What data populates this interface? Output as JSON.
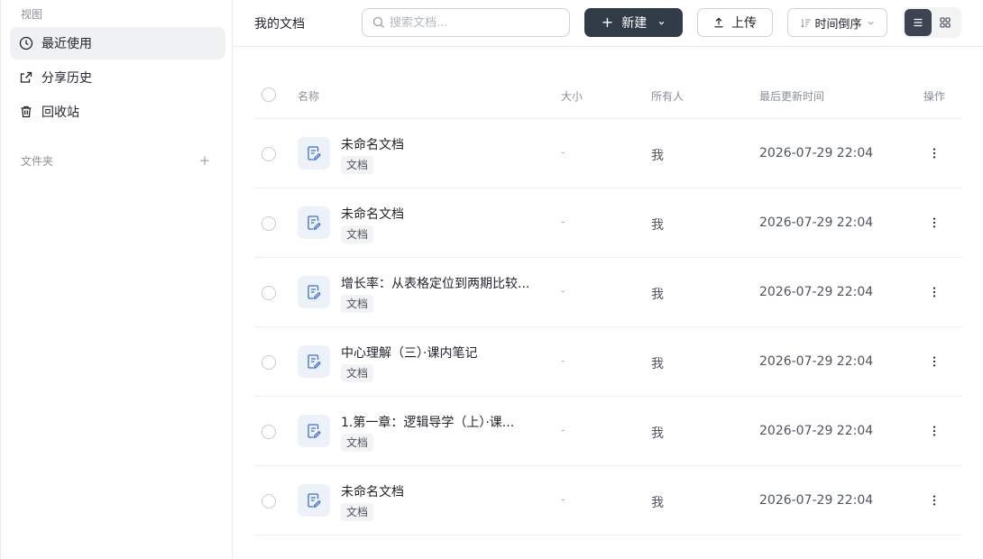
{
  "sidebar": {
    "view_label": "视图",
    "items": [
      {
        "label": "最近使用",
        "icon": "clock-icon",
        "active": true
      },
      {
        "label": "分享历史",
        "icon": "share-icon",
        "active": false
      },
      {
        "label": "回收站",
        "icon": "trash-icon",
        "active": false
      }
    ],
    "folder_label": "文件夹",
    "add_folder": "+"
  },
  "header": {
    "title": "我的文档",
    "search_placeholder": "搜索文档...",
    "new_label": "新建",
    "upload_label": "上传",
    "sort_label": "时间倒序"
  },
  "table": {
    "columns": {
      "name": "名称",
      "size": "大小",
      "owner": "所有人",
      "updated": "最后更新时间",
      "actions": "操作"
    },
    "rows": [
      {
        "name": "未命名文档",
        "tag": "文档",
        "size": "-",
        "owner": "我",
        "updated": "2026-07-29 22:04"
      },
      {
        "name": "未命名文档",
        "tag": "文档",
        "size": "-",
        "owner": "我",
        "updated": "2026-07-29 22:04"
      },
      {
        "name": "增长率：从表格定位到两期比较...",
        "tag": "文档",
        "size": "-",
        "owner": "我",
        "updated": "2026-07-29 22:04"
      },
      {
        "name": "中心理解（三）·课内笔记",
        "tag": "文档",
        "size": "-",
        "owner": "我",
        "updated": "2026-07-29 22:04"
      },
      {
        "name": "1.第一章：逻辑导学（上）·课...",
        "tag": "文档",
        "size": "-",
        "owner": "我",
        "updated": "2026-07-29 22:04"
      },
      {
        "name": "未命名文档",
        "tag": "文档",
        "size": "-",
        "owner": "我",
        "updated": "2026-07-29 22:04"
      }
    ]
  },
  "colors": {
    "accent": "#323b48",
    "active_bg": "#f0f1f3",
    "doc_icon_bg": "#edf2fa",
    "doc_icon": "#3d6fd1"
  }
}
